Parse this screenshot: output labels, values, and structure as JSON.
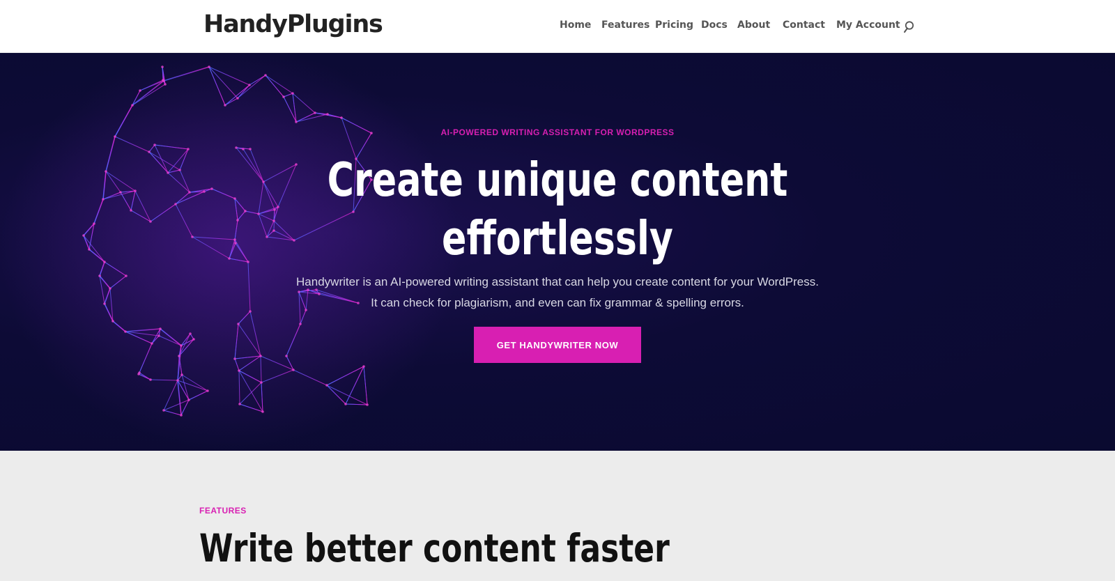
{
  "brand": {
    "logo_text": "HandyPlugins"
  },
  "nav": {
    "items": [
      {
        "label": "Home"
      },
      {
        "label": "Features"
      },
      {
        "label": "Pricing"
      },
      {
        "label": "Docs"
      },
      {
        "label": "About"
      },
      {
        "label": "Contact"
      },
      {
        "label": "My Account"
      }
    ],
    "search_icon": "search-icon"
  },
  "hero": {
    "eyebrow": "AI-POWERED WRITING ASSISTANT FOR WORDPRESS",
    "title_line1": "Create unique content",
    "title_line2": "effortlessly",
    "description_line1": "Handywriter is an AI-powered writing assistant that can help you create content for your WordPress.",
    "description_line2": "It can check for plagiarism, and even can fix grammar & spelling errors.",
    "cta_label": "GET HANDYWRITER NOW",
    "background_image": "digital-face-mesh"
  },
  "features": {
    "eyebrow": "FEATURES",
    "title": "Write better content faster"
  },
  "colors": {
    "accent": "#d81fb2",
    "hero_bg": "#0d0b36",
    "header_bg": "#ffffff",
    "features_bg": "#ececec",
    "nav_text": "#555555"
  }
}
